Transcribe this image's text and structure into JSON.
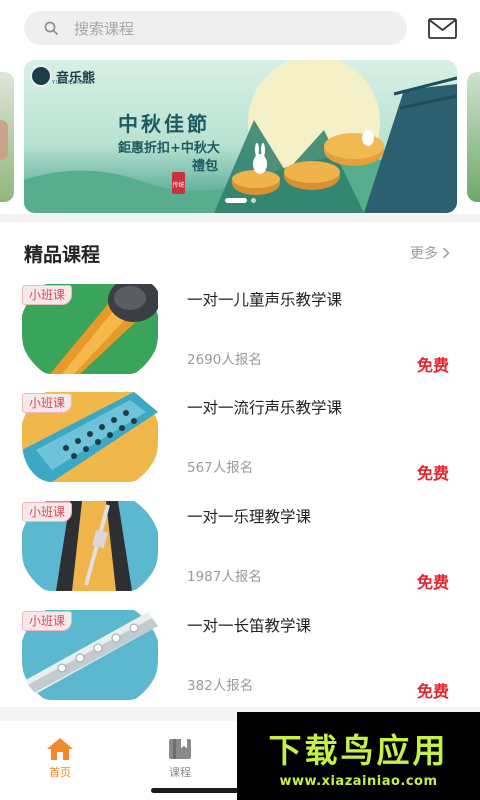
{
  "search": {
    "placeholder": "搜索课程"
  },
  "banner": {
    "logo_name": "音乐熊",
    "logo_sub": "YINYUEXIONG",
    "title": "中秋佳節",
    "line1": "鉅惠折扣+中秋大",
    "line2": "禮包",
    "seal": "传统",
    "page_count": 2,
    "active_page": 1
  },
  "section": {
    "title": "精品课程",
    "more_label": "更多"
  },
  "courses": [
    {
      "tag": "小班课",
      "title": "一对一儿童声乐教学课",
      "enrolled": "2690人报名",
      "price": "免费",
      "art": "microphone"
    },
    {
      "tag": "小班课",
      "title": "一对一流行声乐教学课",
      "enrolled": "567人报名",
      "price": "免费",
      "art": "harmonica"
    },
    {
      "tag": "小班课",
      "title": "一对一乐理教学课",
      "enrolled": "1987人报名",
      "price": "免费",
      "art": "metronome"
    },
    {
      "tag": "小班课",
      "title": "一对一长笛教学课",
      "enrolled": "382人报名",
      "price": "免费",
      "art": "flute"
    }
  ],
  "tabbar": {
    "items": [
      {
        "label": "首页",
        "icon": "home-icon",
        "active": true
      },
      {
        "label": "课程",
        "icon": "book-icon",
        "active": false
      }
    ]
  },
  "watermark": {
    "brand": "下载鸟应用",
    "url": "www.xiazainiao.com"
  },
  "colors": {
    "accent": "#f08a2a",
    "price": "#e8232b",
    "tag_text": "#d94a5a",
    "watermark": "#c7f047"
  }
}
